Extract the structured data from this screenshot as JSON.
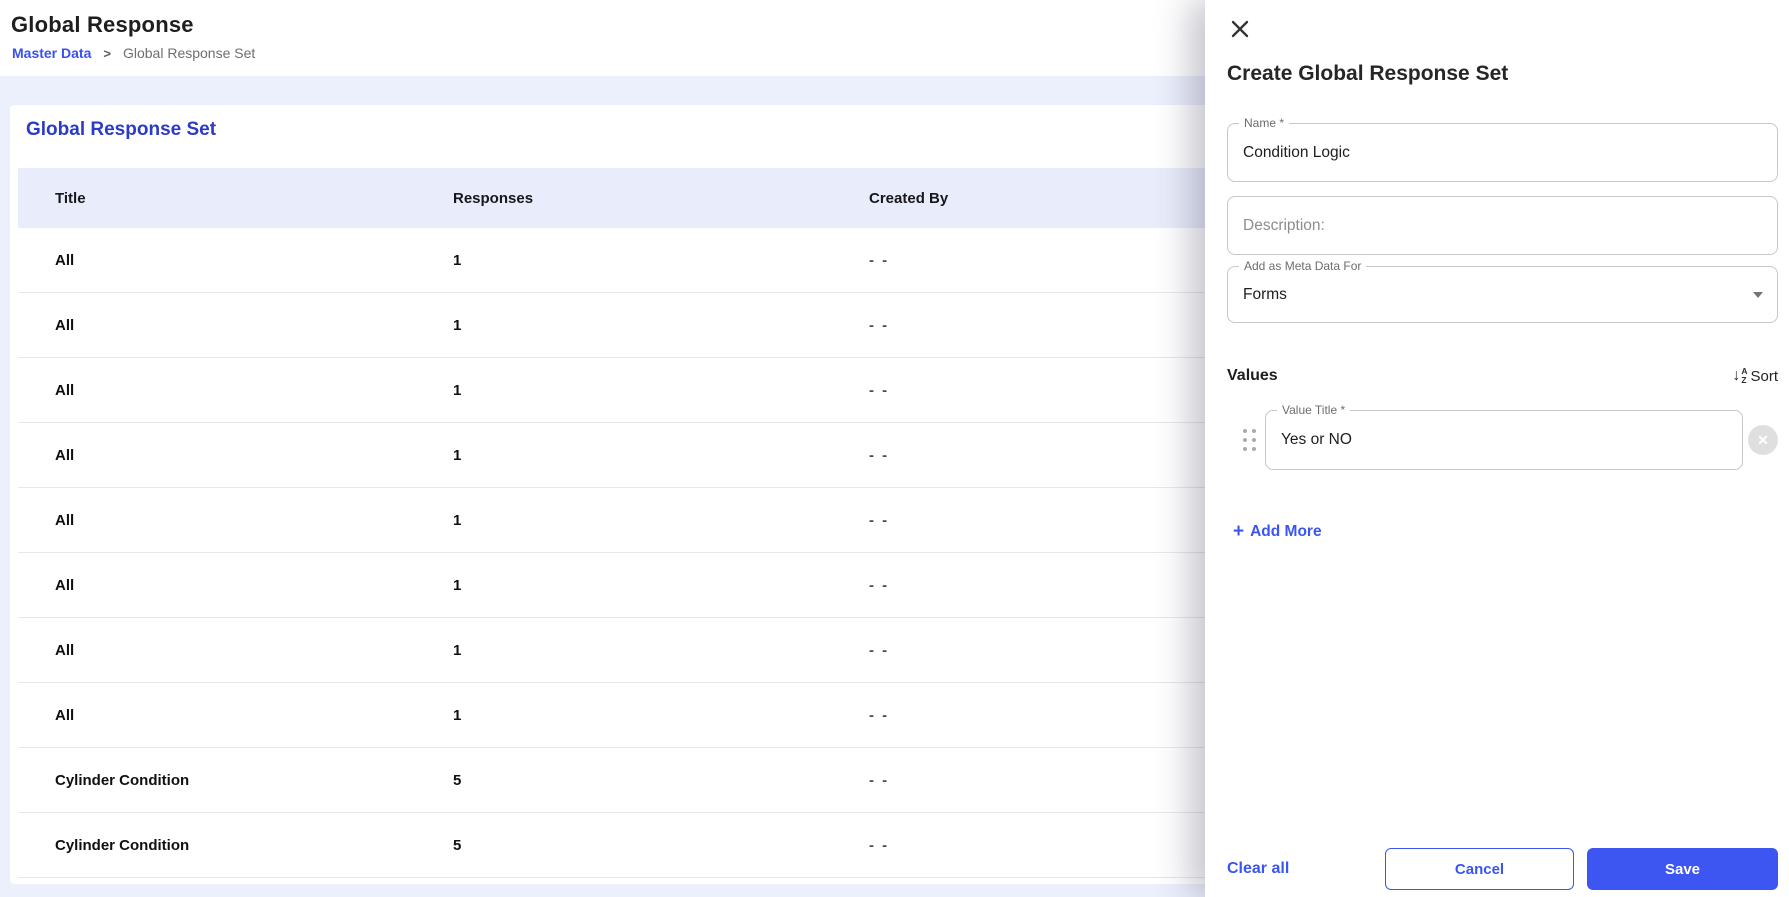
{
  "page": {
    "title": "Global Response",
    "breadcrumb": {
      "link": "Master Data",
      "separator": ">",
      "current": "Global Response Set"
    }
  },
  "card": {
    "title": "Global Response Set",
    "table": {
      "columns": [
        "Title",
        "Responses",
        "Created By"
      ],
      "rows": [
        {
          "title": "All",
          "responses": "1",
          "created_by": "- -"
        },
        {
          "title": "All",
          "responses": "1",
          "created_by": "- -"
        },
        {
          "title": "All",
          "responses": "1",
          "created_by": "- -"
        },
        {
          "title": "All",
          "responses": "1",
          "created_by": "- -"
        },
        {
          "title": "All",
          "responses": "1",
          "created_by": "- -"
        },
        {
          "title": "All",
          "responses": "1",
          "created_by": "- -"
        },
        {
          "title": "All",
          "responses": "1",
          "created_by": "- -"
        },
        {
          "title": "All",
          "responses": "1",
          "created_by": "- -"
        },
        {
          "title": "Cylinder Condition",
          "responses": "5",
          "created_by": "- -"
        },
        {
          "title": "Cylinder Condition",
          "responses": "5",
          "created_by": "- -"
        }
      ]
    }
  },
  "drawer": {
    "title": "Create Global Response Set",
    "fields": {
      "name": {
        "label": "Name *",
        "value": "Condition Logic"
      },
      "description": {
        "placeholder": "Description:"
      },
      "meta": {
        "label": "Add as Meta Data For",
        "value": "Forms"
      }
    },
    "values_section": {
      "heading": "Values",
      "sort_label": "Sort",
      "items": [
        {
          "label": "Value Title *",
          "value": "Yes or NO"
        }
      ],
      "add_more_label": "Add More"
    },
    "footer": {
      "clear_label": "Clear all",
      "cancel_label": "Cancel",
      "save_label": "Save"
    }
  },
  "icons": {
    "close": "✕",
    "remove": "✕",
    "plus": "+",
    "sort_arrow": "↓",
    "sort_a": "A",
    "sort_z": "Z"
  },
  "colors": {
    "accent": "#3A55F0",
    "save_bg": "#3D56F1",
    "card_title": "#2B3BC6",
    "table_header_bg": "#E9EDFB",
    "page_bg": "#ECEFFC"
  }
}
